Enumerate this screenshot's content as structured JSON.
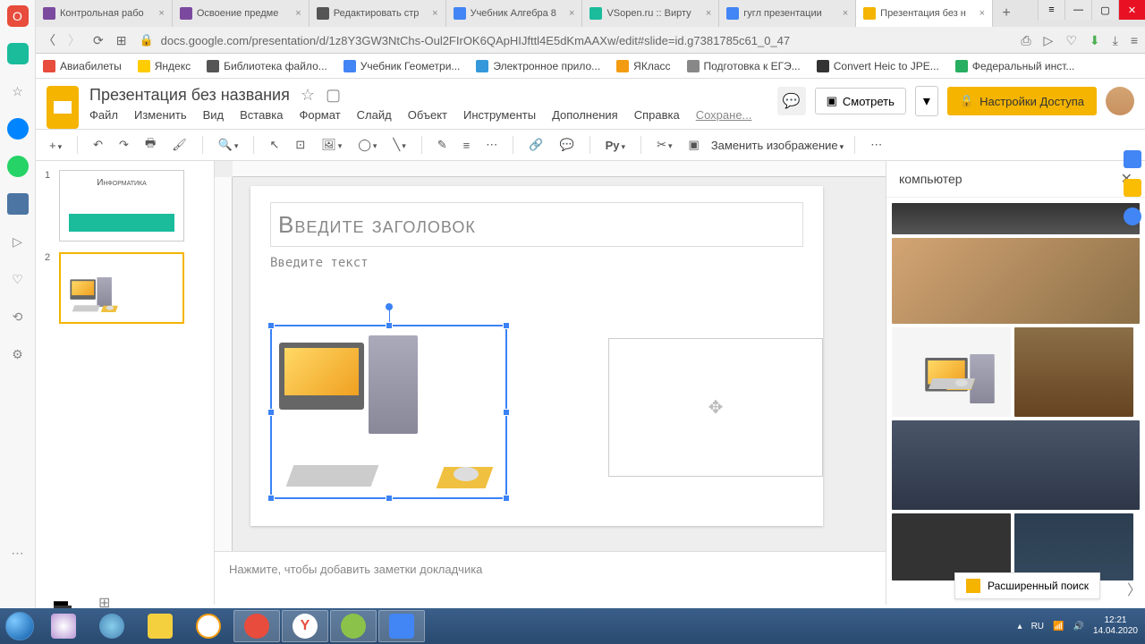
{
  "browser": {
    "tabs": [
      {
        "title": "Контрольная рабо",
        "favicon": "#7b4a9e"
      },
      {
        "title": "Освоение предме",
        "favicon": "#7b4a9e"
      },
      {
        "title": "Редактировать стр",
        "favicon": "#555"
      },
      {
        "title": "Учебник Алгебра 8",
        "favicon": "#4285f4"
      },
      {
        "title": "VSopen.ru :: Вирту",
        "favicon": "#1abc9c"
      },
      {
        "title": "гугл презентации",
        "favicon": "#4285f4"
      },
      {
        "title": "Презентация без н",
        "favicon": "#f4b400"
      }
    ],
    "url": "docs.google.com/presentation/d/1z8Y3GW3NtChs-Oul2FIrOK6QApHIJfttl4E5dKmAAXw/edit#slide=id.g7381785c61_0_47"
  },
  "bookmarks": [
    {
      "label": "Авиабилеты",
      "color": "#e74c3c"
    },
    {
      "label": "Яндекс",
      "color": "#ffcc00"
    },
    {
      "label": "Библиотека файло...",
      "color": "#555"
    },
    {
      "label": "Учебник Геометри...",
      "color": "#4285f4"
    },
    {
      "label": "Электронное прило...",
      "color": "#3498db"
    },
    {
      "label": "ЯКласс",
      "color": "#f39c12"
    },
    {
      "label": "Подготовка к ЕГЭ...",
      "color": "#888"
    },
    {
      "label": "Convert Heic to JPE...",
      "color": "#333"
    },
    {
      "label": "Федеральный инст...",
      "color": "#27ae60"
    }
  ],
  "slides": {
    "doc_title": "Презентация без названия",
    "menus": [
      "Файл",
      "Изменить",
      "Вид",
      "Вставка",
      "Формат",
      "Слайд",
      "Объект",
      "Инструменты",
      "Дополнения",
      "Справка"
    ],
    "saved_label": "Сохране...",
    "present_label": "Смотреть",
    "share_label": "Настройки Доступа",
    "replace_image": "Заменить изображение",
    "title_placeholder": "Введите заголовок",
    "text_placeholder": "Введите текст",
    "notes_placeholder": "Нажмите, чтобы добавить заметки докладчика",
    "thumb1_title": "Информатика"
  },
  "explore": {
    "search_term": "компьютер",
    "adv_search": "Расширенный поиск"
  },
  "taskbar": {
    "lang": "RU",
    "time": "12:21",
    "date": "14.04.2020"
  }
}
